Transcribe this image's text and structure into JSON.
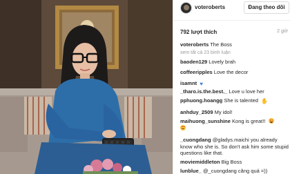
{
  "post": {
    "author": "voteroberts",
    "follow_label": "Đang theo dõi",
    "likes": "792 lượt thích",
    "time": "2 giờ",
    "photo_alt": "Woman with glasses sitting on a sofa"
  },
  "comments": [
    {
      "user": "voteroberts",
      "text": "The Boss"
    },
    {
      "user": "",
      "text": "xem tất cả 23 bình luận"
    },
    {
      "user": "baoden129",
      "text": "Lovely brah"
    },
    {
      "user": "coffeeripples",
      "text": "Love the decor"
    },
    {
      "user": "isamnt",
      "text": ""
    },
    {
      "user": "_tharo.is.the.best._",
      "text": "Love u love her"
    },
    {
      "user": "pphuong.hoangg",
      "text": "She is talented"
    },
    {
      "user": "anhduy_2509",
      "text": "My idol!"
    },
    {
      "user": "maihuong_sunshine",
      "text": "Kong is great!!"
    },
    {
      "user": "_cuongdang",
      "text": "@gladys.maichi you already know who she is. So don't ask him some stupid questions like that."
    },
    {
      "user": "moviemiddleton",
      "text": "Big Boss"
    },
    {
      "user": "lunblue_",
      "text": "@_cuongdang căng quá =))"
    }
  ],
  "icons": {
    "heart": "blue-heart-icon",
    "thumbs": "thumbs-up-icon",
    "smile": "heart-eyes-emoji-icon"
  },
  "colors": {
    "sofa": "#9a8f86",
    "sweater": "#2d6ea8",
    "wall": "#5a4838"
  }
}
